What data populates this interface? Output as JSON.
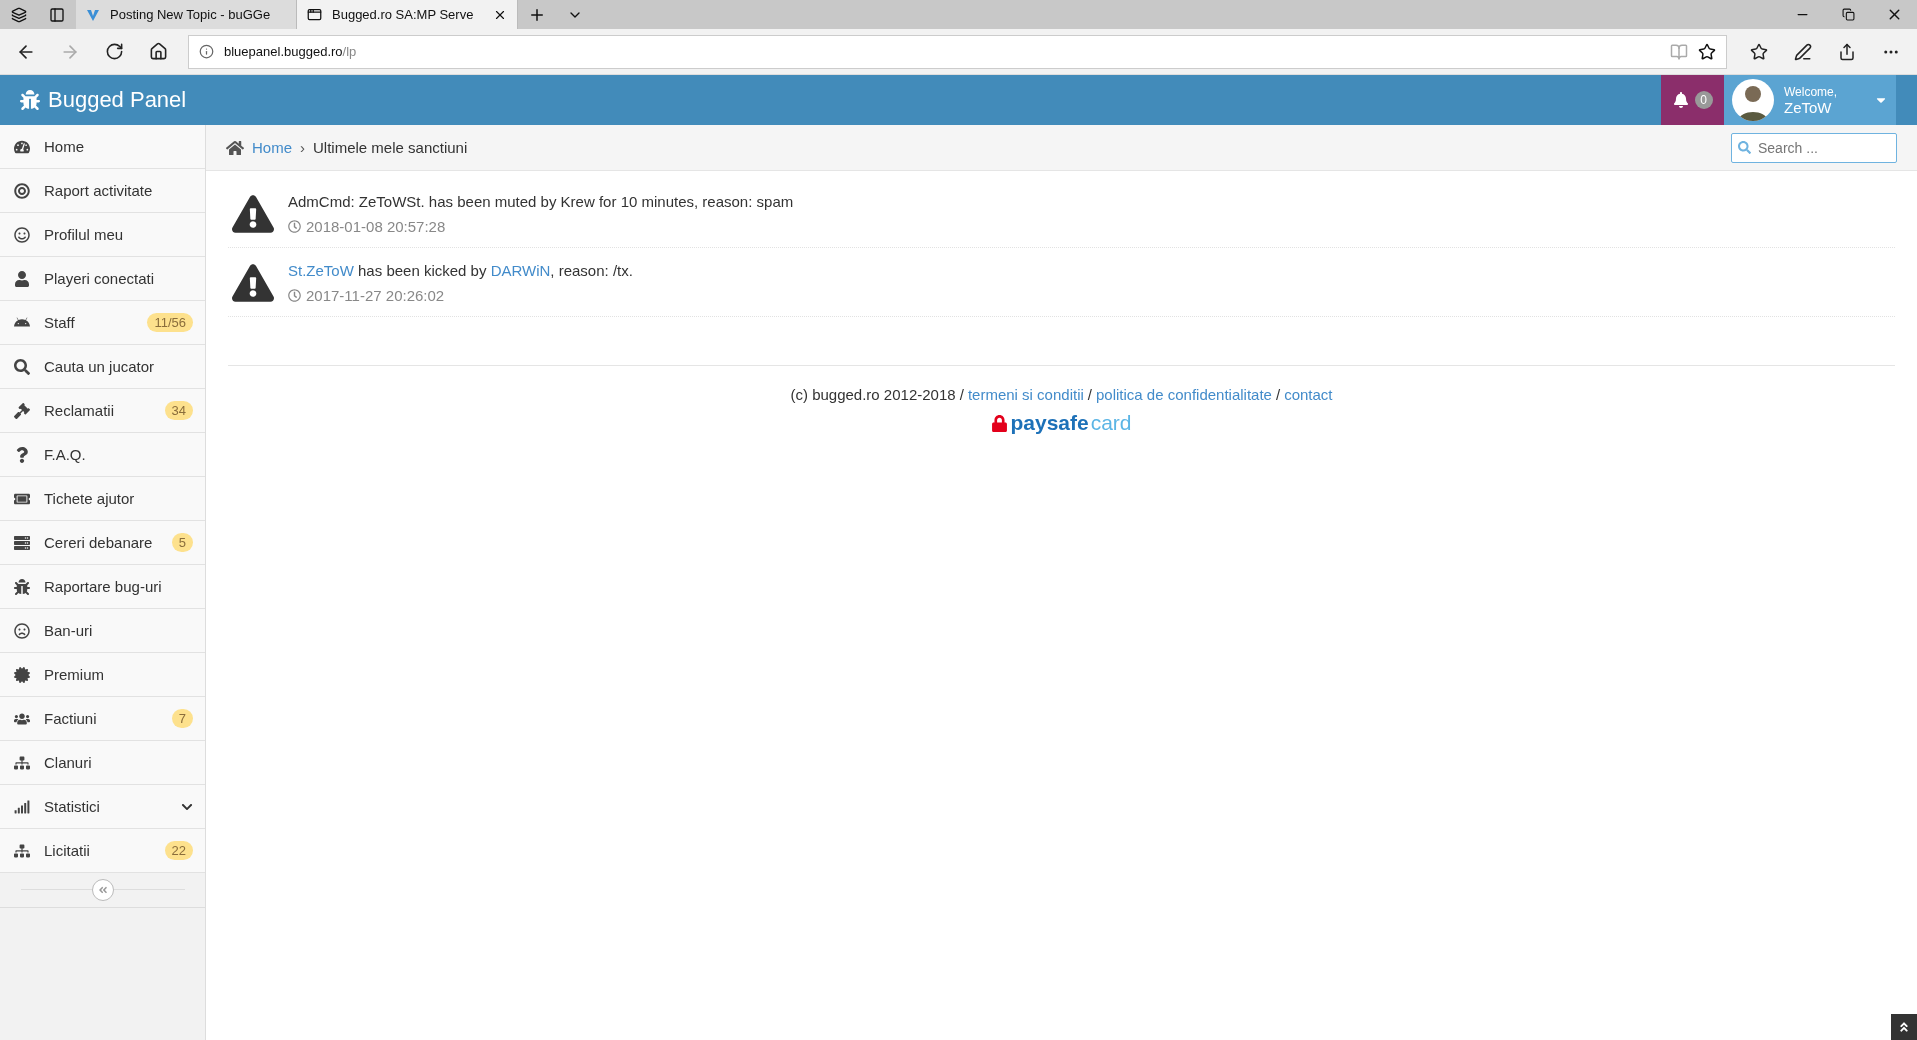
{
  "browser": {
    "tabs": [
      {
        "title": "Posting New Topic - buGGe",
        "selected": false
      },
      {
        "title": "Bugged.ro SA:MP Serve",
        "selected": true
      }
    ],
    "address": {
      "host": "bluepanel.bugged.ro",
      "path": "/lp"
    }
  },
  "header": {
    "brand": "Bugged Panel",
    "notifications": "0",
    "welcome": "Welcome,",
    "user": "ZeToW"
  },
  "breadcrumb": [
    {
      "label": "Home",
      "kind": "link"
    },
    {
      "label": "Ultimele mele sanctiuni",
      "kind": "current",
      "separator": "›"
    }
  ],
  "search": {
    "placeholder": "Search ..."
  },
  "sidebar": {
    "items": [
      {
        "label": "Home",
        "selected": false
      },
      {
        "label": "Raport activitate",
        "selected": false
      },
      {
        "label": "Profilul meu",
        "selected": false
      },
      {
        "label": "Playeri conectati",
        "selected": false
      },
      {
        "label": "Staff",
        "badge": "11/56",
        "selected": false
      },
      {
        "label": "Cauta un jucator",
        "selected": false
      },
      {
        "label": "Reclamatii",
        "badge": "34",
        "selected": false
      },
      {
        "label": "F.A.Q.",
        "selected": false
      },
      {
        "label": "Tichete ajutor",
        "selected": false
      },
      {
        "label": "Cereri debanare",
        "badge": "5",
        "selected": false
      },
      {
        "label": "Raportare bug-uri",
        "selected": false
      },
      {
        "label": "Ban-uri",
        "selected": false
      },
      {
        "label": "Premium",
        "selected": false
      },
      {
        "label": "Factiuni",
        "badge": "7",
        "selected": false
      },
      {
        "label": "Clanuri",
        "selected": false
      },
      {
        "label": "Statistici",
        "expanded": false,
        "selected": false
      },
      {
        "label": "Licitatii",
        "badge": "22",
        "selected": false
      }
    ]
  },
  "sanctions": [
    {
      "parts": [
        {
          "kind": "text",
          "text": "AdmCmd: ZeToWSt. has been muted by Krew for 10 minutes, reason: spam"
        }
      ],
      "time": "2018-01-08 20:57:28"
    },
    {
      "parts": [
        {
          "kind": "link",
          "text": "St.ZeToW"
        },
        {
          "kind": "text",
          "text": " has been kicked by "
        },
        {
          "kind": "link",
          "text": "DARWiN"
        },
        {
          "kind": "text",
          "text": ", reason: /tx."
        }
      ],
      "time": "2017-11-27 20:26:02"
    }
  ],
  "footer": {
    "parts": [
      {
        "kind": "text",
        "text": "(c) bugged.ro 2012-2018 /"
      },
      {
        "kind": "link",
        "text": "termeni si conditii"
      },
      {
        "kind": "text",
        "text": "/"
      },
      {
        "kind": "link",
        "text": "politica de confidentialitate"
      },
      {
        "kind": "text",
        "text": "/"
      },
      {
        "kind": "link",
        "text": "contact"
      }
    ],
    "logo": {
      "first": "paysafe",
      "second": "card"
    }
  }
}
